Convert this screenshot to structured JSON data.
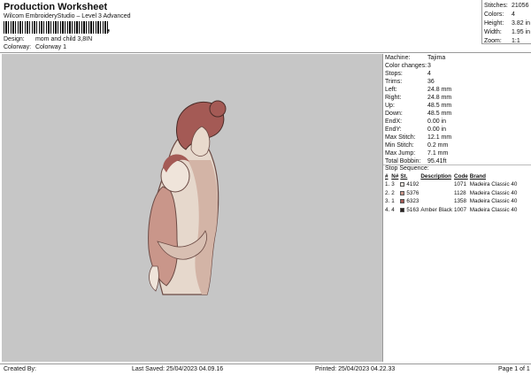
{
  "header": {
    "title": "Production Worksheet",
    "subtitle": "Wilcom EmbroideryStudio – Level 3 Advanced",
    "design_label": "Design:",
    "design_value": "mom and child 3,8IN",
    "colorway_label": "Colorway:",
    "colorway_value": "Colorway 1"
  },
  "top_stats": [
    {
      "label": "Stitches:",
      "value": "21056"
    },
    {
      "label": "Colors:",
      "value": "4"
    },
    {
      "label": "Height:",
      "value": "3.82 in"
    },
    {
      "label": "Width:",
      "value": "1.95 in"
    },
    {
      "label": "Zoom:",
      "value": "1:1"
    }
  ],
  "machine_info": [
    {
      "label": "Machine:",
      "value": "Tajima"
    },
    {
      "label": "Color changes:",
      "value": "3"
    },
    {
      "label": "Stops:",
      "value": "4"
    },
    {
      "label": "Trims:",
      "value": "36"
    },
    {
      "label": "Left:",
      "value": "24.8 mm"
    },
    {
      "label": "Right:",
      "value": "24.8 mm"
    },
    {
      "label": "Up:",
      "value": "48.5 mm"
    },
    {
      "label": "Down:",
      "value": "48.5 mm"
    },
    {
      "label": "EndX:",
      "value": "0.00 in"
    },
    {
      "label": "EndY:",
      "value": "0.00 in"
    },
    {
      "label": "Max Stitch:",
      "value": "12.1 mm"
    },
    {
      "label": "Min Stitch:",
      "value": "0.2 mm"
    },
    {
      "label": "Max Jump:",
      "value": "7.1 mm"
    },
    {
      "label": "Total Bobbin:",
      "value": "95.41ft"
    }
  ],
  "stop_sequence": {
    "title": "Stop Sequence:",
    "headers": {
      "hash": "#",
      "n": "N#",
      "st": "St.",
      "description": "Description",
      "code": "Code",
      "brand": "Brand"
    },
    "rows": [
      {
        "num": "1.",
        "n": "3",
        "color": "#ece4dc",
        "st": "4192",
        "description": "",
        "code": "1071",
        "brand": "Madeira Classic 40"
      },
      {
        "num": "2.",
        "n": "2",
        "color": "#c9968a",
        "st": "5376",
        "description": "",
        "code": "1128",
        "brand": "Madeira Classic 40"
      },
      {
        "num": "3.",
        "n": "1",
        "color": "#a45a55",
        "st": "6323",
        "description": "",
        "code": "1358",
        "brand": "Madeira Classic 40"
      },
      {
        "num": "4.",
        "n": "4",
        "color": "#2a2422",
        "st": "5163",
        "description": "Amber Black",
        "code": "1007",
        "brand": "Madeira Classic 40"
      }
    ]
  },
  "footer": {
    "created_by": "Created By:",
    "last_saved": "Last Saved: 25/04/2023 04.09.16",
    "printed": "Printed: 25/04/2023 04.22.33",
    "page": "Page 1 of 1"
  },
  "colors": {
    "canvas_bg": "#c6c6c6",
    "skin_light": "#ece4dc",
    "skin_mid": "#c9968a",
    "hair": "#a45a55",
    "outline": "#2a2422"
  }
}
